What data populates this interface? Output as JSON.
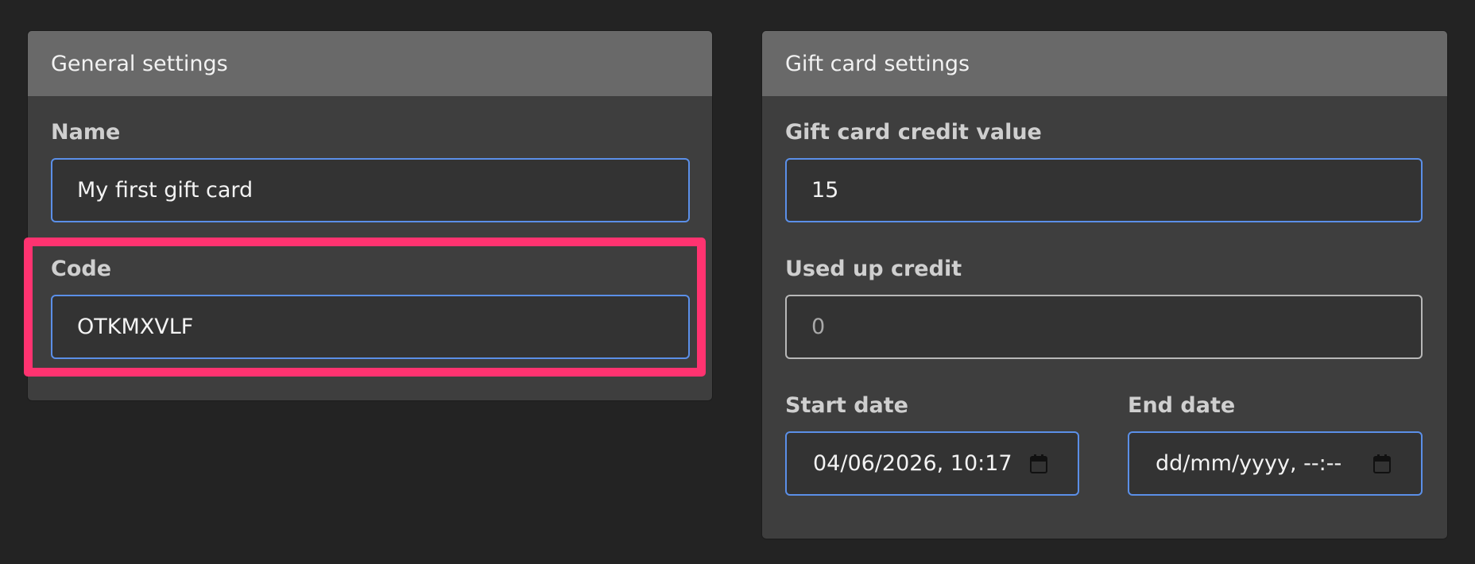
{
  "general": {
    "header": "General settings",
    "name_label": "Name",
    "name_value": "My first gift card",
    "code_label": "Code",
    "code_value": "OTKMXVLF"
  },
  "gift": {
    "header": "Gift card settings",
    "credit_label": "Gift card credit value",
    "credit_value": "15",
    "used_label": "Used up credit",
    "used_value": "0",
    "start_label": "Start date",
    "start_value": "04/06/2026, 10:17",
    "end_label": "End date",
    "end_value": "dd/mm/yyyy, --:--"
  },
  "icons": {
    "calendar": "calendar-icon"
  },
  "colors": {
    "highlight": "#ff3370",
    "focus_border": "#5b8fe8",
    "panel_header": "#696969",
    "panel_body": "#3e3e3e",
    "page_background": "#232323"
  }
}
